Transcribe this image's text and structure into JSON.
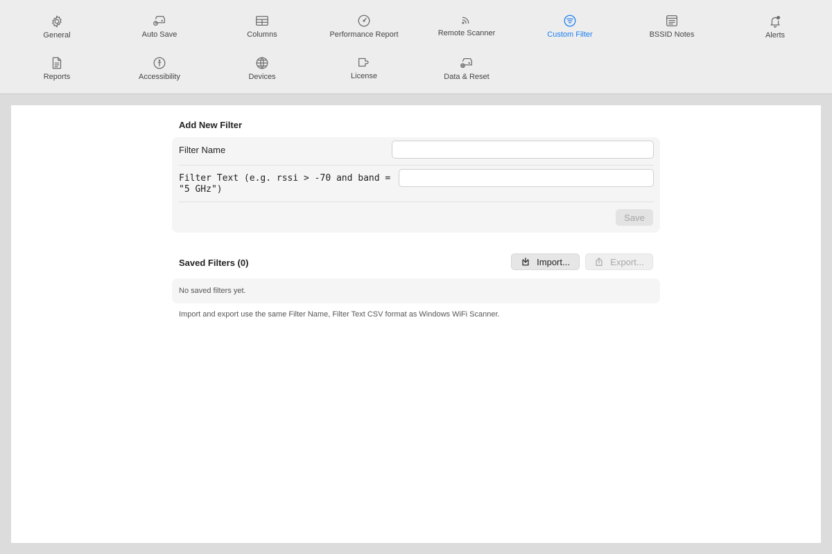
{
  "toolbar": {
    "items": [
      {
        "label": "General",
        "icon": "gear-icon",
        "active": false
      },
      {
        "label": "Auto Save",
        "icon": "drive-clock-icon",
        "active": false
      },
      {
        "label": "Columns",
        "icon": "table-icon",
        "active": false
      },
      {
        "label": "Performance Report",
        "icon": "gauge-icon",
        "active": false
      },
      {
        "label": "Remote Scanner",
        "icon": "signal-icon",
        "active": false
      },
      {
        "label": "Custom Filter",
        "icon": "filter-icon",
        "active": true
      },
      {
        "label": "BSSID Notes",
        "icon": "notes-icon",
        "active": false
      },
      {
        "label": "Alerts",
        "icon": "bell-icon",
        "active": false
      },
      {
        "label": "Reports",
        "icon": "document-icon",
        "active": false
      },
      {
        "label": "Accessibility",
        "icon": "accessibility-icon",
        "active": false
      },
      {
        "label": "Devices",
        "icon": "globe-icon",
        "active": false
      },
      {
        "label": "License",
        "icon": "license-icon",
        "active": false
      },
      {
        "label": "Data & Reset",
        "icon": "drive-reset-icon",
        "active": false
      }
    ],
    "active_color": "#1a7ff2"
  },
  "add_filter": {
    "title": "Add New Filter",
    "name_label": "Filter Name",
    "name_value": "",
    "text_label": "Filter Text (e.g. rssi > -70 and band = \"5 GHz\")",
    "text_value": "",
    "save_label": "Save"
  },
  "saved_filters": {
    "title": "Saved Filters (0)",
    "import_label": "Import...",
    "export_label": "Export...",
    "empty_text": "No saved filters yet.",
    "footnote": "Import and export use the same Filter Name, Filter Text CSV format as Windows WiFi Scanner."
  }
}
